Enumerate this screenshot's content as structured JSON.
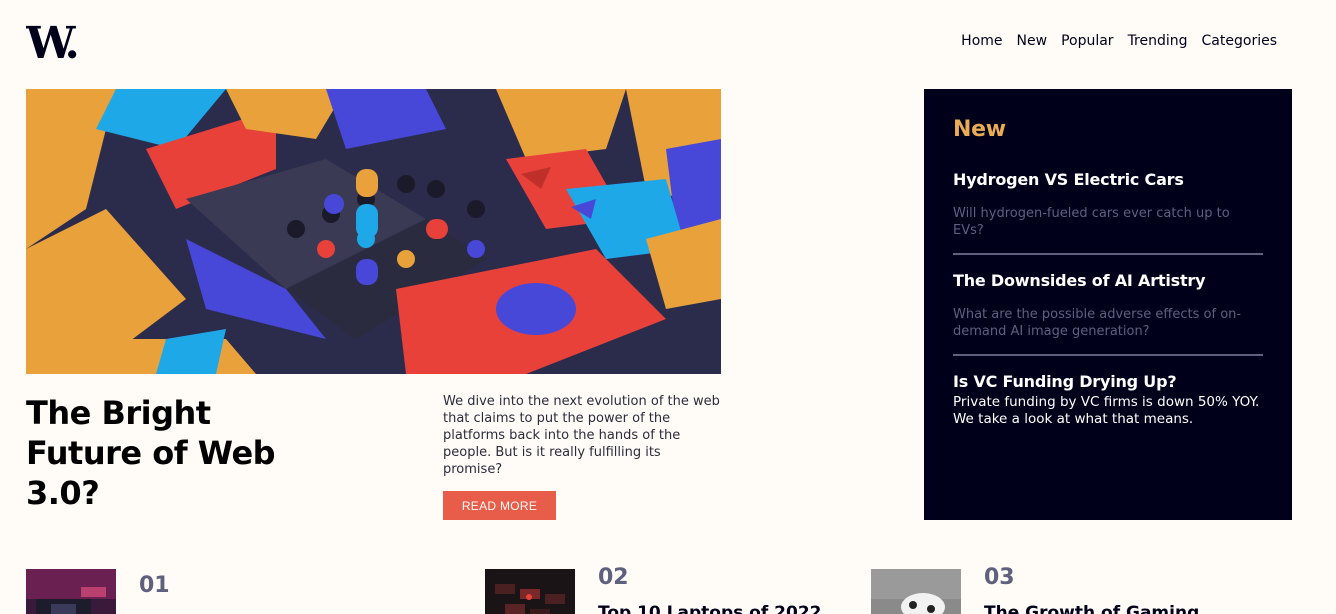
{
  "brand": {
    "logo_text": "W."
  },
  "nav": {
    "items": [
      "Home",
      "New",
      "Popular",
      "Trending",
      "Categories"
    ]
  },
  "hero": {
    "title": "The Bright Future of Web 3.0?",
    "description": "We dive into the next evolution of the web that claims to put the power of the platforms back into the hands of the people. But is it really fulfilling its promise?",
    "button_label": "READ MORE"
  },
  "new_panel": {
    "heading": "New",
    "items": [
      {
        "title": "Hydrogen VS Electric Cars",
        "text": "Will hydrogen-fueled cars ever catch up to EVs?"
      },
      {
        "title": "The Downsides of AI Artistry",
        "text": "What are the possible adverse effects of on-demand AI image generation?"
      },
      {
        "title": "Is VC Funding Drying Up?",
        "text": "Private funding by VC firms is down 50% YOY. We take a look at what that means."
      }
    ]
  },
  "cards": [
    {
      "number": "01",
      "title": ""
    },
    {
      "number": "02",
      "title": "Top 10 Laptops of 2022"
    },
    {
      "number": "03",
      "title": "The Growth of Gaming"
    }
  ],
  "colors": {
    "background": "#fffcf8",
    "dark": "#00001a",
    "accent_orange": "#e9ab53",
    "accent_red": "#e85d4a",
    "muted": "#5e607e"
  }
}
